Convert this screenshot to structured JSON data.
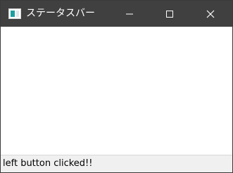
{
  "window": {
    "title": "ステータスバー"
  },
  "titlebar": {
    "background": "#404040",
    "buttons": [
      {
        "name": "minimize",
        "icon": "minimize-icon"
      },
      {
        "name": "maximize",
        "icon": "maximize-icon"
      },
      {
        "name": "close",
        "icon": "close-icon"
      }
    ]
  },
  "status_bar": {
    "text": "left button clicked!!"
  }
}
